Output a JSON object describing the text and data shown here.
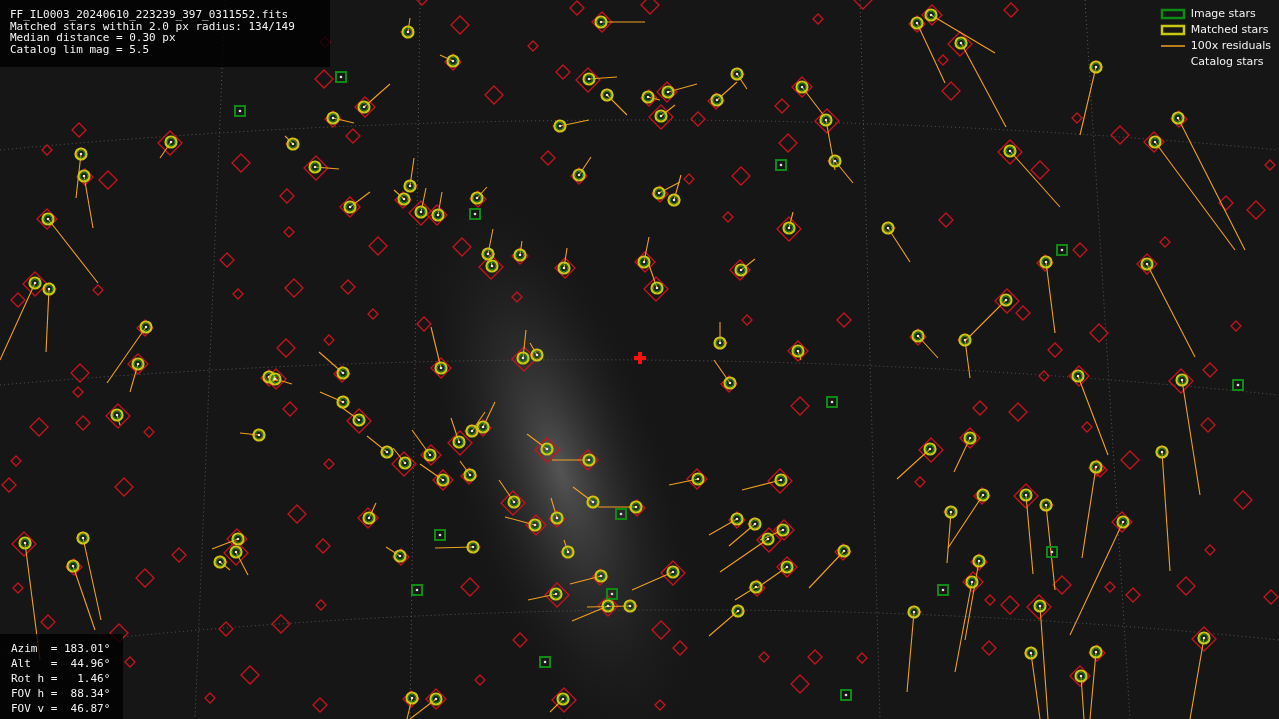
{
  "info": {
    "lines": [
      "FF_IL0003_20240610_223239_397_0311552.fits",
      "Matched stars within 2.0 px radius: 134/149",
      "Median distance = 0.30 px",
      "Catalog lim mag = 5.5"
    ]
  },
  "legend": {
    "items": [
      {
        "kind": "image",
        "label": "Image stars"
      },
      {
        "kind": "matched",
        "label": "Matched stars"
      },
      {
        "kind": "residual",
        "label": "100x residuals"
      },
      {
        "kind": "catalog",
        "label": "Catalog stars"
      }
    ]
  },
  "pointing": {
    "lines": [
      "Azim  = 183.01°",
      "Alt   =  44.96°",
      "Rot h =   1.46°",
      "FOV h =  88.34°",
      "FOV v =  46.87°"
    ]
  }
}
